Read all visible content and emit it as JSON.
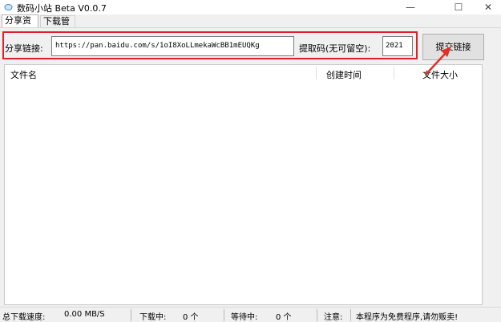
{
  "window": {
    "title": "数码小站 Beta V0.0.7",
    "controls": {
      "minimize": "—",
      "maximize": "☐",
      "close": "✕"
    }
  },
  "tabs": [
    {
      "label": "分享资源",
      "active": true
    },
    {
      "label": "下载管理",
      "active": false
    }
  ],
  "form": {
    "share_link_label": "分享链接:",
    "share_link_value": "https://pan.baidu.com/s/1oI8XoLLmekaWcBB1mEUQKg",
    "code_label": "提取码(无可留空):",
    "code_value": "2021",
    "submit_label": "提交链接"
  },
  "table": {
    "columns": [
      "文件名",
      "创建时间",
      "文件大小"
    ],
    "rows": []
  },
  "status": {
    "total_speed_label": "总下载速度:",
    "total_speed_value": "0.00 MB/S",
    "downloading_label": "下载中:",
    "downloading_value": "0 个",
    "waiting_label": "等待中:",
    "waiting_value": "0 个",
    "notice_label": "注意:",
    "notice_value": "本程序为免费程序,请勿贩卖!"
  },
  "colors": {
    "highlight_box": "#d9232a",
    "arrow": "#e0302a"
  }
}
